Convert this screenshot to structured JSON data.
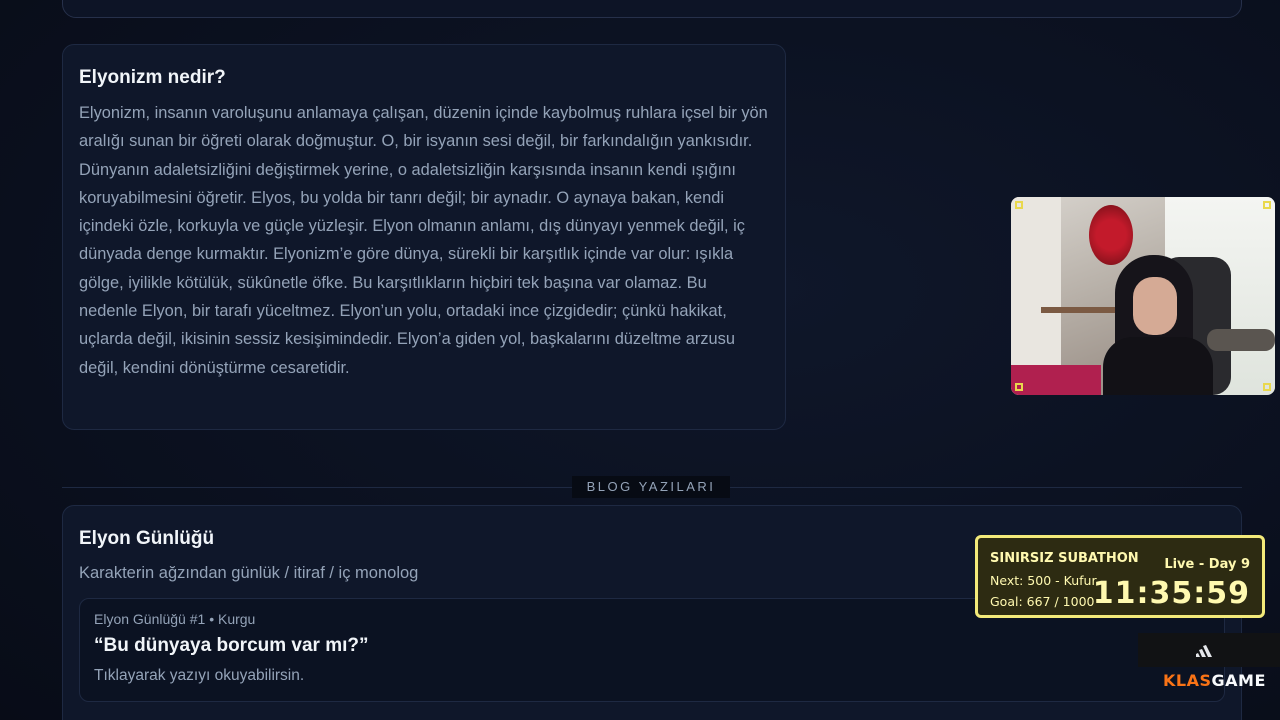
{
  "about": {
    "title": "Elyonizm nedir?",
    "body": "Elyonizm, insanın varoluşunu anlamaya çalışan, düzenin içinde kaybolmuş ruhlara içsel bir yön aralığı sunan bir öğreti olarak doğmuştur. O, bir isyanın sesi değil, bir farkındalığın yankısıdır. Dünyanın adaletsizliğini değiştirmek yerine, o adaletsizliğin karşısında insanın kendi ışığını koruyabilmesini öğretir. Elyos, bu yolda bir tanrı değil; bir aynadır. O aynaya bakan, kendi içindeki özle, korkuyla ve güçle yüzleşir. Elyon olmanın anlamı, dış dünyayı yenmek değil, iç dünyada denge kurmaktır. Elyonizm’e göre dünya, sürekli bir karşıtlık içinde var olur: ışıkla gölge, iyilikle kötülük, sükûnetle öfke. Bu karşıtlıkların hiçbiri tek başına var olamaz. Bu nedenle Elyon, bir tarafı yüceltmez. Elyon’un yolu, ortadaki ince çizgidedir; çünkü hakikat, uçlarda değil, ikisinin sessiz kesişimindedir. Elyon’a giden yol, başkalarını düzeltme arzusu değil, kendini dönüştürme cesaretidir."
  },
  "section": {
    "label": "BLOG YAZILARI"
  },
  "blog": {
    "title": "Elyon Günlüğü",
    "subtitle": "Karakterin ağzından günlük / itiraf / iç monolog",
    "post": {
      "meta": "Elyon Günlüğü #1 • Kurgu",
      "title": "“Bu dünyaya borcum var mı?”",
      "hint": "Tıklayarak yazıyı okuyabilirsin."
    }
  },
  "overlay": {
    "subathon_title": "SINIRSIZ SUBATHON",
    "live": "Live - Day 9",
    "next": "Next: 500 - Kufur",
    "goal": "Goal: 667 / 1000",
    "timer": "11:35:59",
    "brand_part1": "KLAS",
    "brand_part2": "GAME",
    "accent": "#f3ea7a",
    "brand_color": "#f97316"
  }
}
